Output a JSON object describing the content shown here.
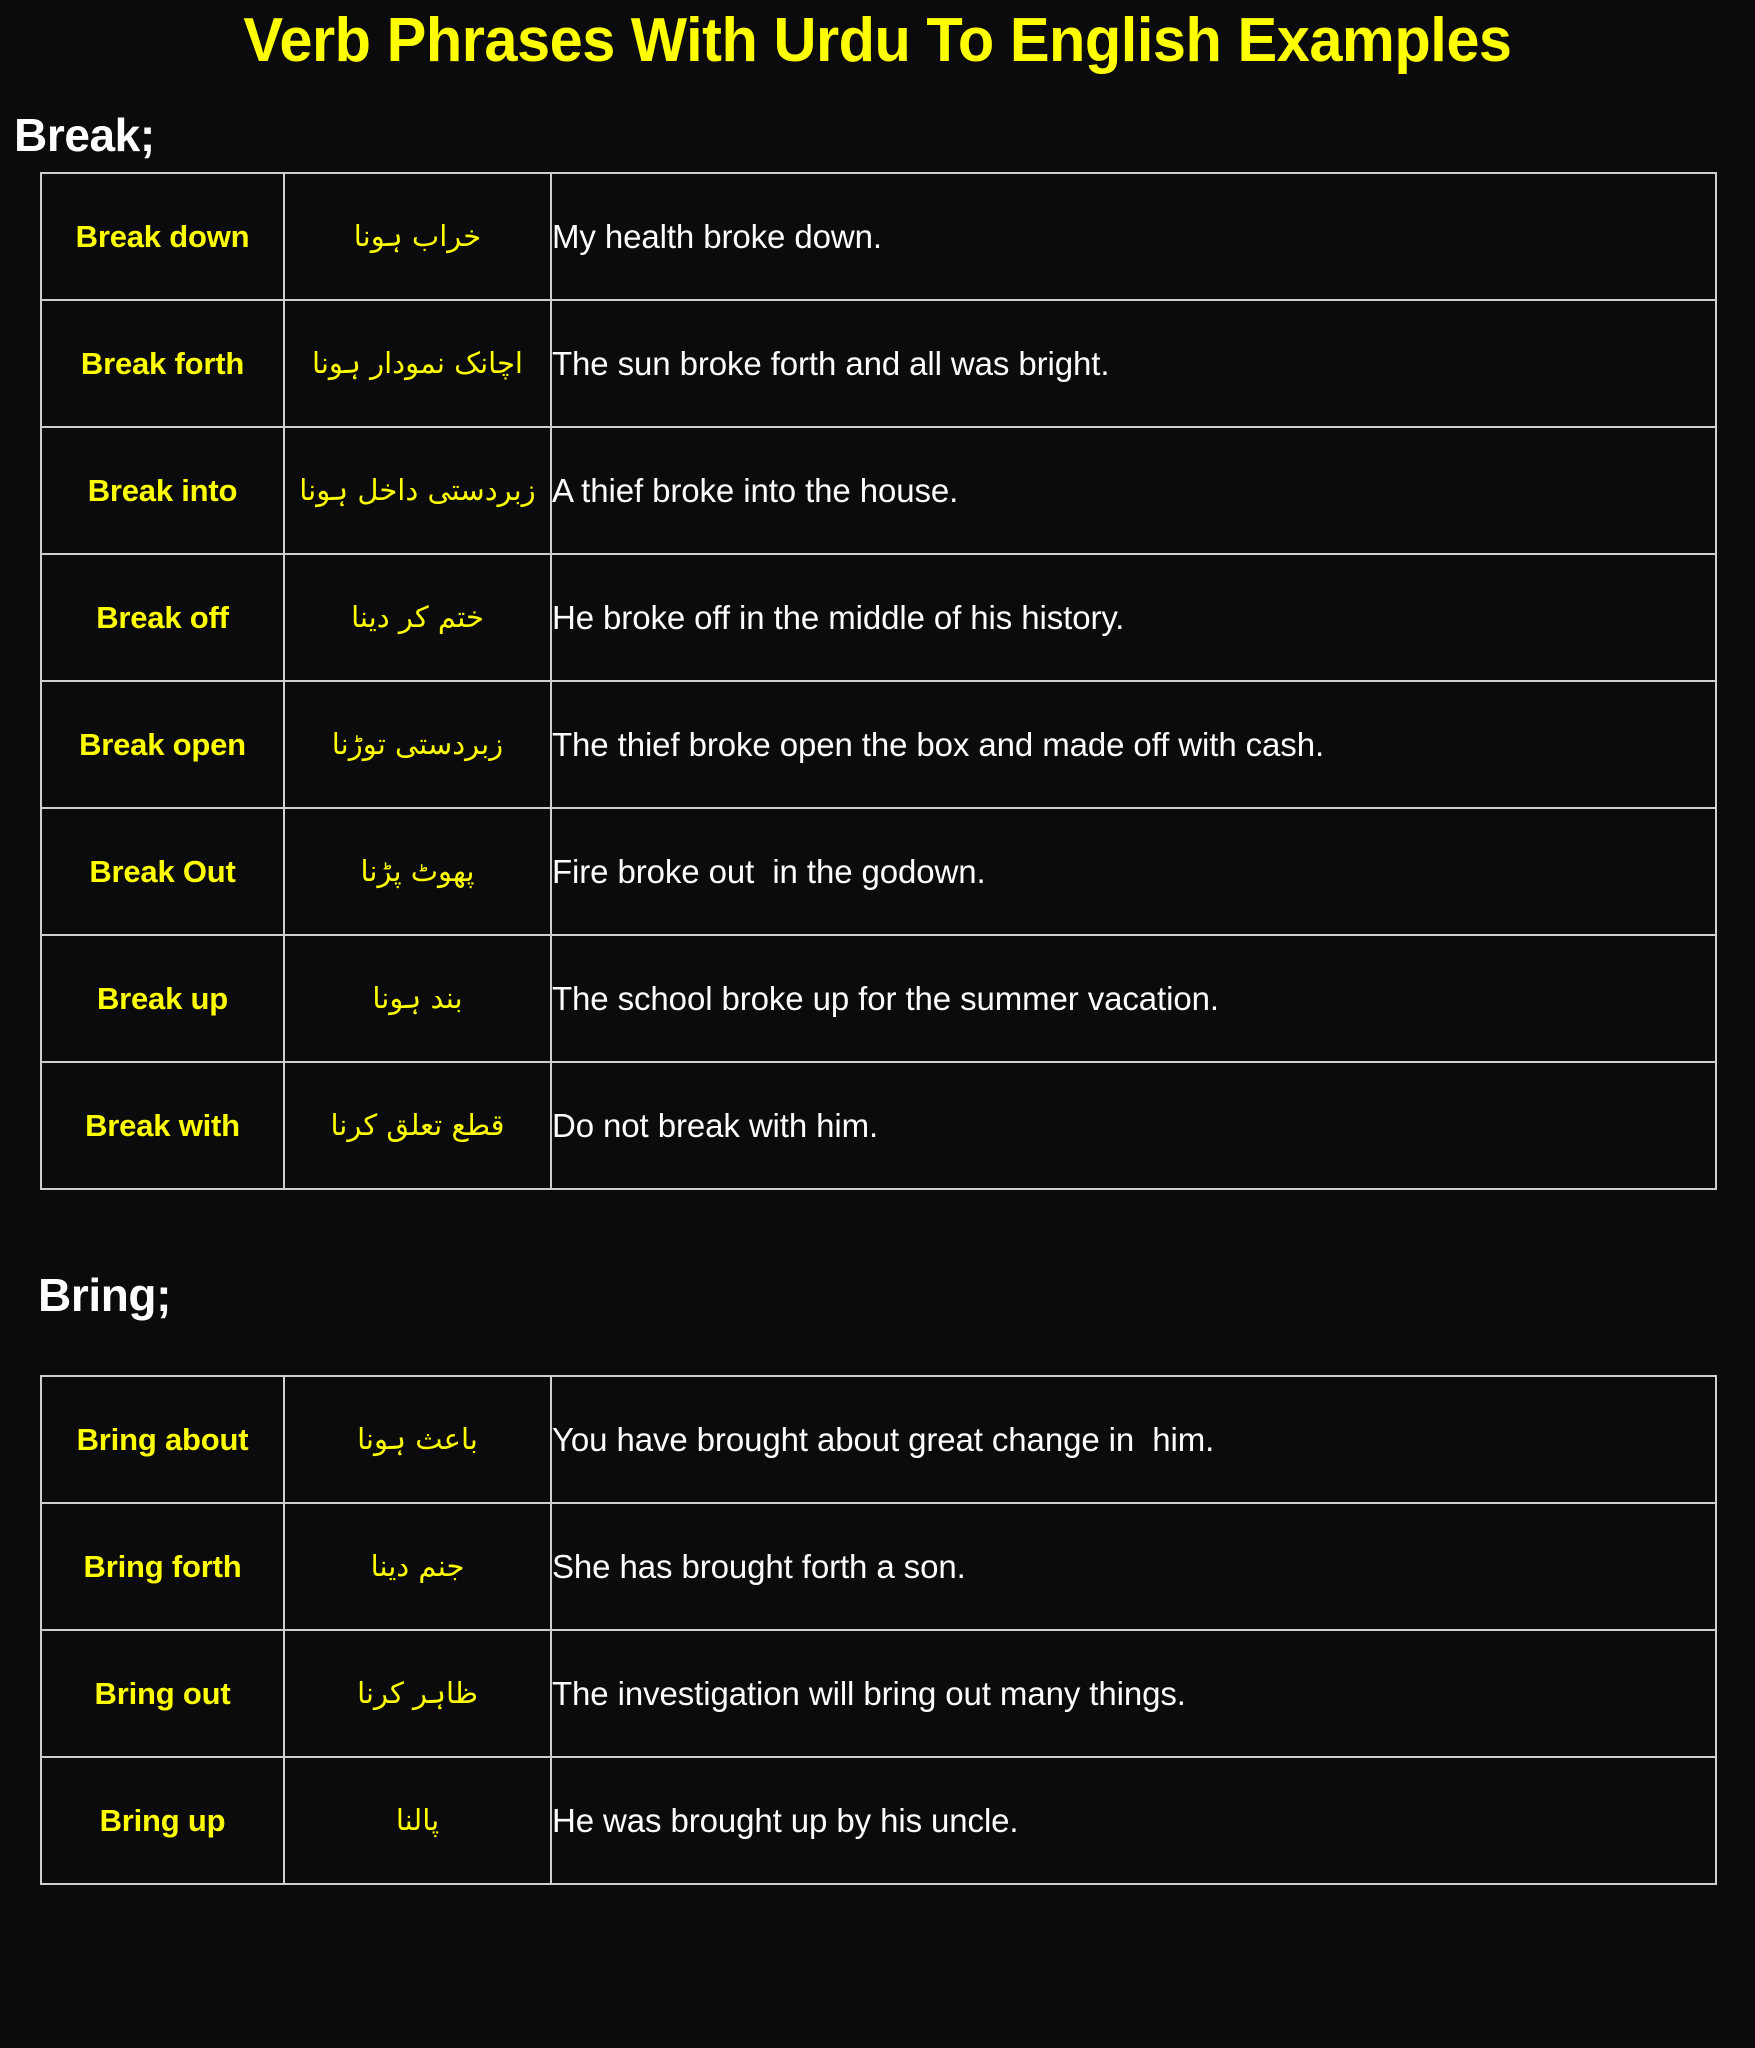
{
  "document": {
    "title": "Verb Phrases With Urdu To English Examples",
    "theme": {
      "background": "#0b0b0b",
      "accent_yellow": "#ffff00",
      "text_white": "#fdfdfd",
      "table_border": "#cfcfcf"
    }
  },
  "sections": [
    {
      "heading": "Break;",
      "rows": [
        {
          "phrase": "Break down",
          "urdu": "خراب ہونا",
          "english": "My health broke down."
        },
        {
          "phrase": "Break forth",
          "urdu": "اچانک نمودار ہونا",
          "english": "The sun broke forth and all was bright."
        },
        {
          "phrase": "Break into",
          "urdu": "زبردستی داخل ہونا",
          "english": "A thief broke into the house."
        },
        {
          "phrase": "Break off",
          "urdu": "ختم کر دینا",
          "english": "He broke off in the middle of his history."
        },
        {
          "phrase": "Break open",
          "urdu": "زبردستی توڑنا",
          "english": "The thief broke open the box and made off with cash."
        },
        {
          "phrase": "Break Out",
          "urdu": "پھوٹ پڑنا",
          "english": "Fire broke out  in the godown."
        },
        {
          "phrase": "Break up",
          "urdu": "بند ہونا",
          "english": "The school broke up for the summer vacation."
        },
        {
          "phrase": "Break with",
          "urdu": "قطع تعلق کرنا",
          "english": "Do not break with him."
        }
      ]
    },
    {
      "heading": "Bring;",
      "rows": [
        {
          "phrase": "Bring about",
          "urdu": "باعث ہونا",
          "english": "You have brought about great change in  him."
        },
        {
          "phrase": "Bring forth",
          "urdu": "جنم دینا",
          "english": "She has brought forth a son."
        },
        {
          "phrase": "Bring out",
          "urdu": "ظاہر کرنا",
          "english": "The investigation will bring out many things."
        },
        {
          "phrase": "Bring up",
          "urdu": "پالنا",
          "english": "He was brought up by his uncle."
        }
      ]
    }
  ]
}
